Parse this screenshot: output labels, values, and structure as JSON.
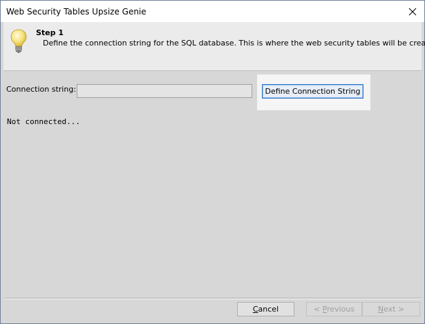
{
  "window": {
    "title": "Web Security Tables Upsize Genie"
  },
  "header": {
    "step_title": "Step 1",
    "step_description": "Define the connection string for the SQL database. This is where the web security tables will be created.",
    "icon": "lightbulb-icon"
  },
  "connection": {
    "label": "Connection string:",
    "value": "",
    "button_label": "Define Connection String"
  },
  "status": {
    "text": "Not connected..."
  },
  "footer": {
    "cancel": {
      "accel": "C",
      "rest": "ancel"
    },
    "previous": {
      "prefix": "< ",
      "accel": "P",
      "rest": "revious",
      "enabled": false
    },
    "next": {
      "accel": "N",
      "rest": "ext >",
      "enabled": false
    }
  },
  "colors": {
    "accent_border": "#2f74c8",
    "dialog_background": "#d7d7d7",
    "header_background": "#ebebeb"
  }
}
